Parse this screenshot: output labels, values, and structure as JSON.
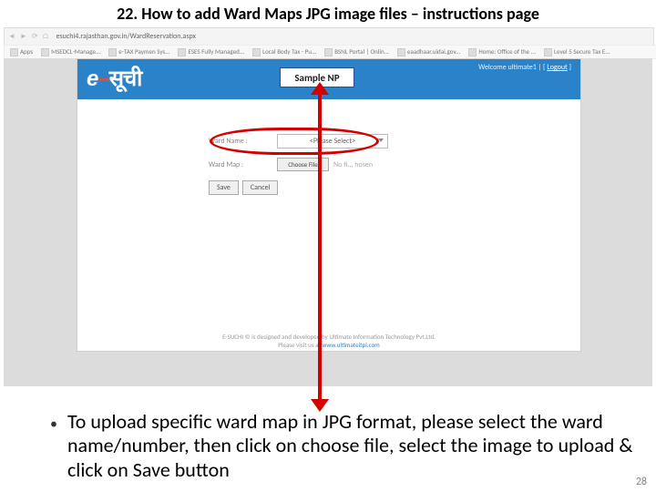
{
  "title": "22. How to add Ward Maps JPG image files – instructions page",
  "browser": {
    "url": "esuchi4.rajasthan.gov.in/WardReservation.aspx",
    "bookmarks": [
      "Apps",
      "MSEDCL-Manage...",
      "e-TAX Paymen Sys...",
      "ESES Fully Managed...",
      "Local Body Tax - Pu...",
      "BSNL Portal | Onlin...",
      "eaadhaar.uidai.gov...",
      "Home: Office of the ...",
      "Level 5 Secure Tax E..."
    ]
  },
  "header": {
    "logo_e": "e",
    "logo_dash": "–",
    "logo_rest": "सूची",
    "welcome": "Welcome ultimate1 |",
    "logout": "Logout"
  },
  "callout": {
    "label": "Sample NP"
  },
  "form": {
    "wardName_label": "Ward Name :",
    "wardName_value": "<Please Select>",
    "wardMap_label": "Ward Map :",
    "choose_label": "Choose File",
    "nofile": "No fi... hosen",
    "save": "Save",
    "cancel": "Cancel"
  },
  "footer": {
    "line1": "E-SUCHI © is designed and developed by Ultimate Information Technology Pvt.Ltd.",
    "line2a": "Please visit us at ",
    "link": "www.ultimateitpl.com"
  },
  "bullet": "To upload specific ward map in JPG format, please select the ward name/number, then click on choose file, select the image to upload & click on Save button",
  "pageNumber": "28"
}
